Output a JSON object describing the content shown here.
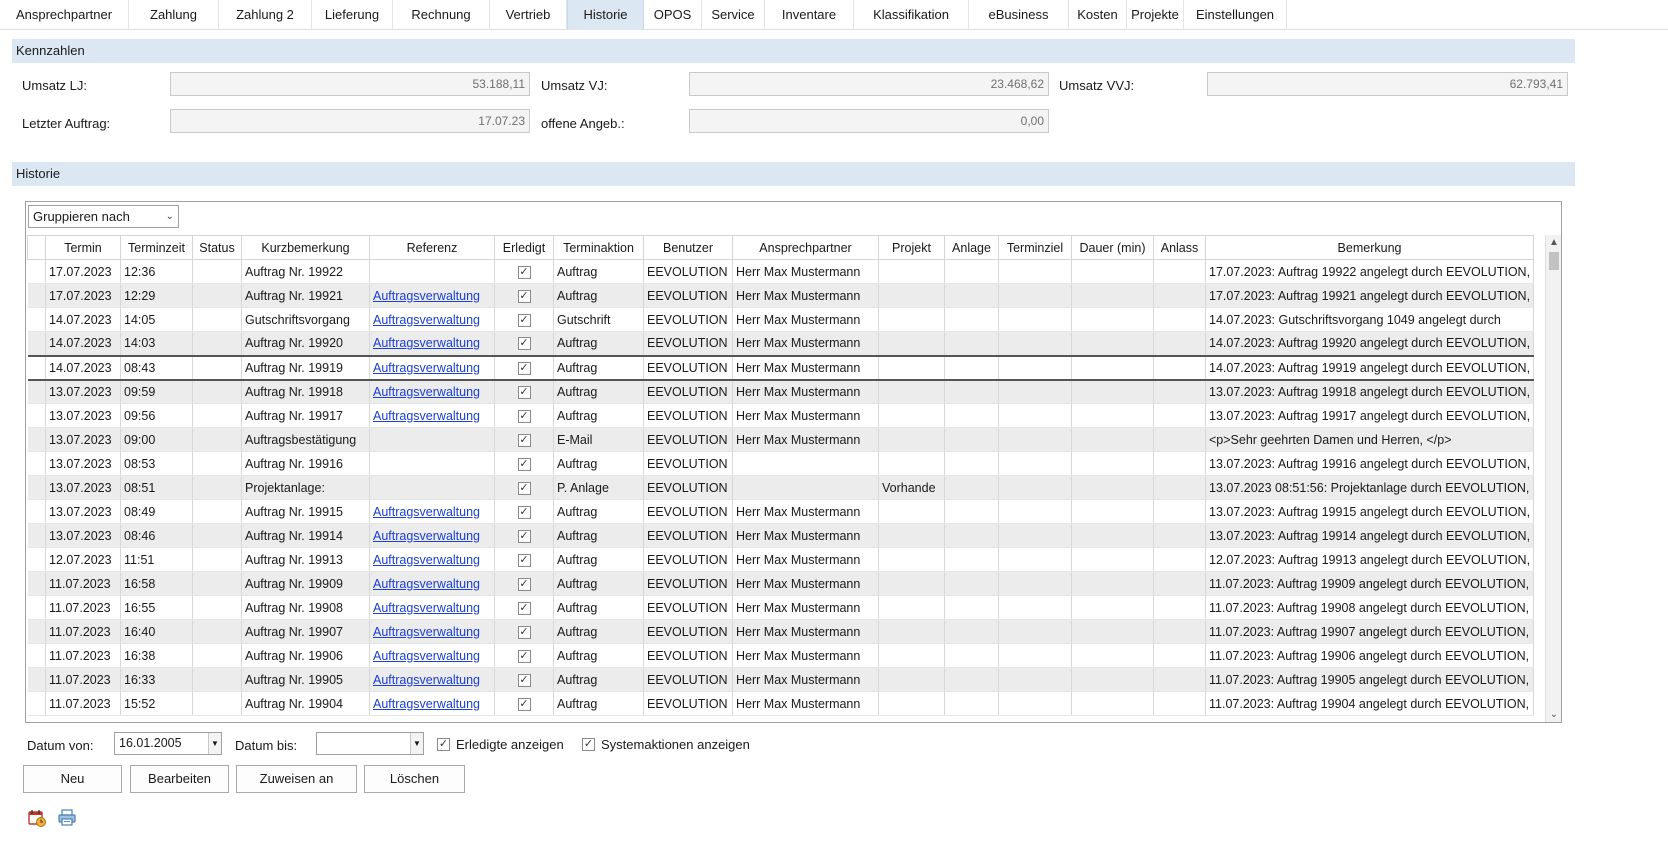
{
  "tabs": [
    "Ansprechpartner",
    "Zahlung",
    "Zahlung 2",
    "Lieferung",
    "Rechnung",
    "Vertrieb",
    "Historie",
    "OPOS",
    "Service",
    "Inventare",
    "Klassifikation",
    "eBusiness",
    "Kosten",
    "Projekte",
    "Einstellungen"
  ],
  "active_tab": "Historie",
  "kennzahlen": {
    "title": "Kennzahlen",
    "umsatz_lj_label": "Umsatz LJ:",
    "umsatz_lj": "53.188,11",
    "umsatz_vj_label": "Umsatz VJ:",
    "umsatz_vj": "23.468,62",
    "umsatz_vvj_label": "Umsatz VVJ:",
    "umsatz_vvj": "62.793,41",
    "letzter_auftrag_label": "Letzter Auftrag:",
    "letzter_auftrag": "17.07.23",
    "offene_angeb_label": "offene Angeb.:",
    "offene_angeb": "0,00"
  },
  "historie": {
    "title": "Historie",
    "group_by": "Gruppieren nach",
    "columns": [
      "Termin",
      "Terminzeit",
      "Status",
      "Kurzbemerkung",
      "Referenz",
      "Erledigt",
      "Terminaktion",
      "Benutzer",
      "Ansprechpartner",
      "Projekt",
      "Anlage",
      "Terminziel",
      "Dauer (min)",
      "Anlass",
      "Bemerkung"
    ],
    "rows": [
      {
        "termin": "17.07.2023",
        "zeit": "12:36",
        "status": "",
        "kurz": "Auftrag Nr. 19922",
        "ref": "",
        "erledigt": true,
        "aktion": "Auftrag",
        "benutzer": "EEVOLUTION",
        "ansprech": "Herr Max Mustermann",
        "projekt": "",
        "bem": "17.07.2023: Auftrag 19922 angelegt durch EEVOLUTION,"
      },
      {
        "termin": "17.07.2023",
        "zeit": "12:29",
        "status": "",
        "kurz": "Auftrag Nr. 19921",
        "ref": "Auftragsverwaltung",
        "erledigt": true,
        "aktion": "Auftrag",
        "benutzer": "EEVOLUTION",
        "ansprech": "Herr Max Mustermann",
        "projekt": "",
        "bem": "17.07.2023: Auftrag 19921 angelegt durch EEVOLUTION,"
      },
      {
        "termin": "14.07.2023",
        "zeit": "14:05",
        "status": "",
        "kurz": "Gutschriftsvorgang",
        "ref": "Auftragsverwaltung",
        "erledigt": true,
        "aktion": "Gutschrift",
        "benutzer": "EEVOLUTION",
        "ansprech": "Herr Max Mustermann",
        "projekt": "",
        "bem": "14.07.2023: Gutschriftsvorgang 1049 angelegt durch"
      },
      {
        "termin": "14.07.2023",
        "zeit": "14:03",
        "status": "",
        "kurz": "Auftrag Nr. 19920",
        "ref": "Auftragsverwaltung",
        "erledigt": true,
        "aktion": "Auftrag",
        "benutzer": "EEVOLUTION",
        "ansprech": "Herr Max Mustermann",
        "projekt": "",
        "bem": "14.07.2023: Auftrag 19920 angelegt durch EEVOLUTION,"
      },
      {
        "termin": "14.07.2023",
        "zeit": "08:43",
        "status": "",
        "kurz": "Auftrag Nr. 19919",
        "ref": "Auftragsverwaltung",
        "erledigt": true,
        "aktion": "Auftrag",
        "benutzer": "EEVOLUTION",
        "ansprech": "Herr Max Mustermann",
        "projekt": "",
        "bem": "14.07.2023: Auftrag 19919 angelegt durch EEVOLUTION,"
      },
      {
        "termin": "13.07.2023",
        "zeit": "09:59",
        "status": "",
        "kurz": "Auftrag Nr. 19918",
        "ref": "Auftragsverwaltung",
        "erledigt": true,
        "aktion": "Auftrag",
        "benutzer": "EEVOLUTION",
        "ansprech": "Herr Max Mustermann",
        "projekt": "",
        "bem": "13.07.2023: Auftrag 19918 angelegt durch EEVOLUTION,"
      },
      {
        "termin": "13.07.2023",
        "zeit": "09:56",
        "status": "",
        "kurz": "Auftrag Nr. 19917",
        "ref": "Auftragsverwaltung",
        "erledigt": true,
        "aktion": "Auftrag",
        "benutzer": "EEVOLUTION",
        "ansprech": "Herr Max Mustermann",
        "projekt": "",
        "bem": "13.07.2023: Auftrag 19917 angelegt durch EEVOLUTION,"
      },
      {
        "termin": "13.07.2023",
        "zeit": "09:00",
        "status": "",
        "kurz": "Auftragsbestätigung",
        "ref": "",
        "erledigt": true,
        "aktion": "E-Mail",
        "benutzer": "EEVOLUTION",
        "ansprech": "Herr Max Mustermann",
        "projekt": "",
        "bem": "<p>Sehr geehrten Damen und Herren, </p>"
      },
      {
        "termin": "13.07.2023",
        "zeit": "08:53",
        "status": "",
        "kurz": "Auftrag Nr. 19916",
        "ref": "",
        "erledigt": true,
        "aktion": "Auftrag",
        "benutzer": "EEVOLUTION",
        "ansprech": "",
        "projekt": "",
        "bem": "13.07.2023: Auftrag 19916 angelegt durch EEVOLUTION,"
      },
      {
        "termin": "13.07.2023",
        "zeit": "08:51",
        "status": "",
        "kurz": "Projektanlage:",
        "ref": "",
        "erledigt": true,
        "aktion": "P. Anlage",
        "benutzer": "EEVOLUTION",
        "ansprech": "",
        "projekt": "Vorhande",
        "bem": "13.07.2023 08:51:56: Projektanlage durch EEVOLUTION,"
      },
      {
        "termin": "13.07.2023",
        "zeit": "08:49",
        "status": "",
        "kurz": "Auftrag Nr. 19915",
        "ref": "Auftragsverwaltung",
        "erledigt": true,
        "aktion": "Auftrag",
        "benutzer": "EEVOLUTION",
        "ansprech": "Herr Max Mustermann",
        "projekt": "",
        "bem": "13.07.2023: Auftrag 19915 angelegt durch EEVOLUTION,"
      },
      {
        "termin": "13.07.2023",
        "zeit": "08:46",
        "status": "",
        "kurz": "Auftrag Nr. 19914",
        "ref": "Auftragsverwaltung",
        "erledigt": true,
        "aktion": "Auftrag",
        "benutzer": "EEVOLUTION",
        "ansprech": "Herr Max Mustermann",
        "projekt": "",
        "bem": "13.07.2023: Auftrag 19914 angelegt durch EEVOLUTION,"
      },
      {
        "termin": "12.07.2023",
        "zeit": "11:51",
        "status": "",
        "kurz": "Auftrag Nr. 19913",
        "ref": "Auftragsverwaltung",
        "erledigt": true,
        "aktion": "Auftrag",
        "benutzer": "EEVOLUTION",
        "ansprech": "Herr Max Mustermann",
        "projekt": "",
        "bem": "12.07.2023: Auftrag 19913 angelegt durch EEVOLUTION,"
      },
      {
        "termin": "11.07.2023",
        "zeit": "16:58",
        "status": "",
        "kurz": "Auftrag Nr. 19909",
        "ref": "Auftragsverwaltung",
        "erledigt": true,
        "aktion": "Auftrag",
        "benutzer": "EEVOLUTION",
        "ansprech": "Herr Max Mustermann",
        "projekt": "",
        "bem": "11.07.2023: Auftrag 19909 angelegt durch EEVOLUTION,"
      },
      {
        "termin": "11.07.2023",
        "zeit": "16:55",
        "status": "",
        "kurz": "Auftrag Nr. 19908",
        "ref": "Auftragsverwaltung",
        "erledigt": true,
        "aktion": "Auftrag",
        "benutzer": "EEVOLUTION",
        "ansprech": "Herr Max Mustermann",
        "projekt": "",
        "bem": "11.07.2023: Auftrag 19908 angelegt durch EEVOLUTION,"
      },
      {
        "termin": "11.07.2023",
        "zeit": "16:40",
        "status": "",
        "kurz": "Auftrag Nr. 19907",
        "ref": "Auftragsverwaltung",
        "erledigt": true,
        "aktion": "Auftrag",
        "benutzer": "EEVOLUTION",
        "ansprech": "Herr Max Mustermann",
        "projekt": "",
        "bem": "11.07.2023: Auftrag 19907 angelegt durch EEVOLUTION,"
      },
      {
        "termin": "11.07.2023",
        "zeit": "16:38",
        "status": "",
        "kurz": "Auftrag Nr. 19906",
        "ref": "Auftragsverwaltung",
        "erledigt": true,
        "aktion": "Auftrag",
        "benutzer": "EEVOLUTION",
        "ansprech": "Herr Max Mustermann",
        "projekt": "",
        "bem": "11.07.2023: Auftrag 19906 angelegt durch EEVOLUTION,"
      },
      {
        "termin": "11.07.2023",
        "zeit": "16:33",
        "status": "",
        "kurz": "Auftrag Nr. 19905",
        "ref": "Auftragsverwaltung",
        "erledigt": true,
        "aktion": "Auftrag",
        "benutzer": "EEVOLUTION",
        "ansprech": "Herr Max Mustermann",
        "projekt": "",
        "bem": "11.07.2023: Auftrag 19905 angelegt durch EEVOLUTION,"
      },
      {
        "termin": "11.07.2023",
        "zeit": "15:52",
        "status": "",
        "kurz": "Auftrag Nr. 19904",
        "ref": "Auftragsverwaltung",
        "erledigt": true,
        "aktion": "Auftrag",
        "benutzer": "EEVOLUTION",
        "ansprech": "Herr Max Mustermann",
        "projekt": "",
        "bem": "11.07.2023: Auftrag 19904 angelegt durch EEVOLUTION,"
      }
    ],
    "selected_row": 4
  },
  "filters": {
    "datum_von_label": "Datum von:",
    "datum_von": "16.01.2005",
    "datum_bis_label": "Datum bis:",
    "datum_bis": "",
    "erledigte_label": "Erledigte anzeigen",
    "erledigte_checked": true,
    "system_label": "Systemaktionen anzeigen",
    "system_checked": true
  },
  "buttons": {
    "neu": "Neu",
    "bearbeiten": "Bearbeiten",
    "zuweisen": "Zuweisen an",
    "loeschen": "Löschen"
  },
  "icons": [
    "calendar-clock-icon",
    "printer-icon"
  ],
  "colors": {
    "section_bg": "#dbe8f4",
    "active_tab_bg": "#dbe8f4",
    "link": "#1a3ed6",
    "alt_row": "#ececec"
  }
}
